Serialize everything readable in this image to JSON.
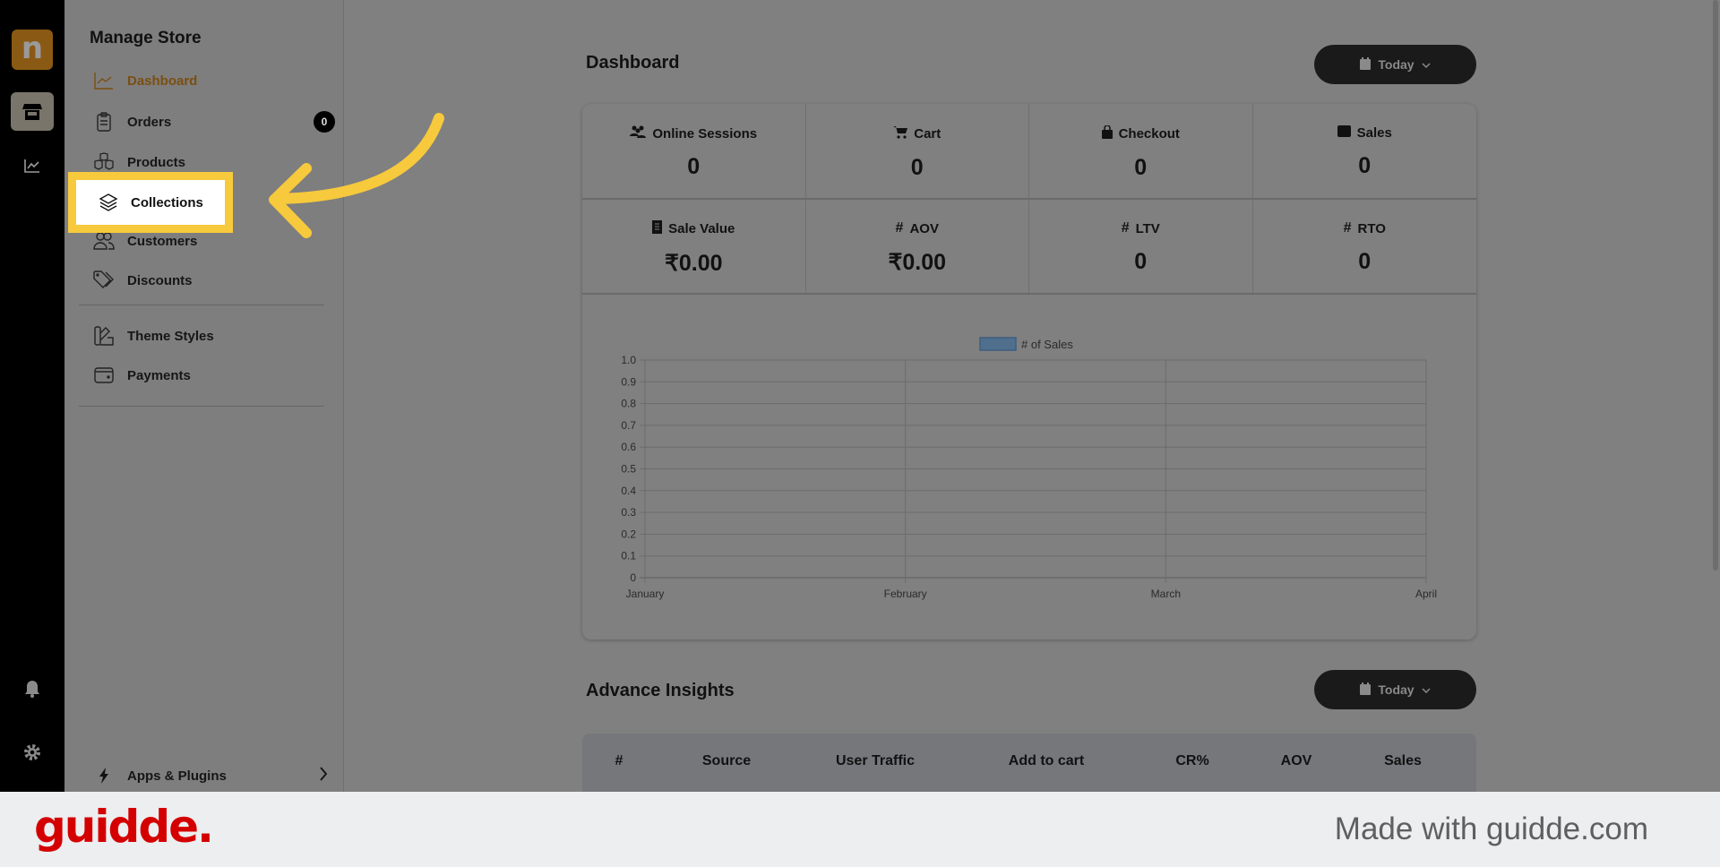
{
  "rail": {
    "icons": [
      "store-icon",
      "analytics-icon",
      "bell-icon",
      "gear-icon"
    ]
  },
  "sidebar": {
    "title": "Manage Store",
    "items": [
      {
        "label": "Dashboard",
        "icon": "chart-line-icon",
        "active": true
      },
      {
        "label": "Orders",
        "icon": "clipboard-icon",
        "badge": "0"
      },
      {
        "label": "Products",
        "icon": "boxes-icon"
      },
      {
        "label": "Collections",
        "icon": "layers-icon",
        "highlighted": true
      },
      {
        "label": "Customers",
        "icon": "users-icon"
      },
      {
        "label": "Discounts",
        "icon": "tag-icon"
      },
      {
        "label": "Theme Styles",
        "icon": "palette-icon"
      },
      {
        "label": "Payments",
        "icon": "wallet-icon"
      }
    ],
    "apps": "Apps & Plugins"
  },
  "dashboard": {
    "title": "Dashboard",
    "range": "Today",
    "stats": [
      {
        "label": "Online Sessions",
        "value": "0",
        "icon": "users-icon"
      },
      {
        "label": "Cart",
        "value": "0",
        "icon": "cart-icon"
      },
      {
        "label": "Checkout",
        "value": "0",
        "icon": "bag-icon"
      },
      {
        "label": "Sales",
        "value": "0",
        "icon": "wallet-icon"
      },
      {
        "label": "Sale Value",
        "value": "₹0.00",
        "icon": "receipt-icon"
      },
      {
        "label": "AOV",
        "value": "₹0.00",
        "icon": "hash-icon"
      },
      {
        "label": "LTV",
        "value": "0",
        "icon": "hash-icon"
      },
      {
        "label": "RTO",
        "value": "0",
        "icon": "hash-icon"
      }
    ]
  },
  "chart_data": {
    "type": "line",
    "categories": [
      "January",
      "February",
      "March",
      "April"
    ],
    "series": [
      {
        "name": "# of Sales",
        "values": [],
        "color": "#4f6f8c"
      }
    ],
    "yticks": [
      "0",
      "0.1",
      "0.2",
      "0.3",
      "0.4",
      "0.5",
      "0.6",
      "0.7",
      "0.8",
      "0.9",
      "1.0"
    ],
    "ylim": [
      0,
      1
    ],
    "grid": true,
    "legend": "top-center"
  },
  "insights": {
    "title": "Advance Insights",
    "range": "Today",
    "columns": [
      "#",
      "Source",
      "User Traffic",
      "Add to cart",
      "CR%",
      "AOV",
      "Sales"
    ]
  },
  "footer": {
    "logo": "guidde.",
    "credit": "Made with guidde.com",
    "brand_color": "#d40000"
  },
  "annotation": {
    "color": "#f7c93c"
  }
}
